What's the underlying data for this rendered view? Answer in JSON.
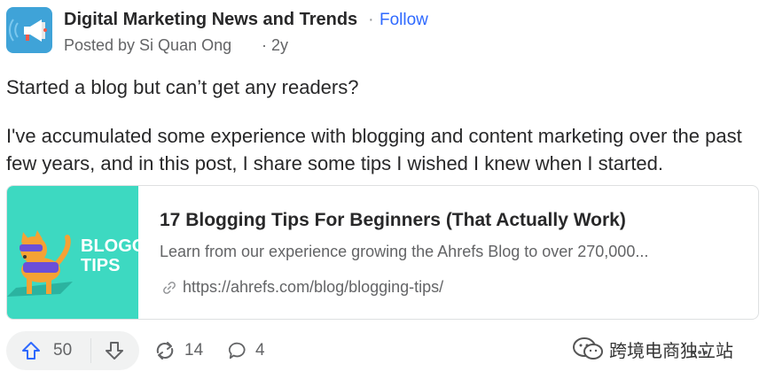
{
  "post": {
    "space_name": "Digital Marketing News and Trends",
    "separator": "·",
    "follow_label": "Follow",
    "posted_by": "Posted by Si Quan Ong",
    "time": "· 2y",
    "title": "Started a blog but can’t get any readers?",
    "body": "I've accumulated some experience with blogging and content marketing over the past few years, and in this post, I share some tips I wished I knew when I started."
  },
  "link_card": {
    "thumb_text_line1": "BLOGG",
    "thumb_text_line2": "TIPS",
    "title": "17 Blogging Tips For Beginners (That Actually Work)",
    "description": "Learn from our experience growing the Ahrefs Blog to over 270,000...",
    "url": "https://ahrefs.com/blog/blogging-tips/"
  },
  "actions": {
    "upvotes": "50",
    "shares": "14",
    "comments": "4"
  },
  "watermark": {
    "text": "跨境电商独立站"
  },
  "icons": {
    "avatar": "megaphone-icon",
    "upvote": "arrow-up-icon",
    "downvote": "arrow-down-icon",
    "share": "share-icon",
    "comment": "comment-icon",
    "link": "link-icon",
    "more": "more-icon"
  },
  "colors": {
    "accent": "#2e69ff",
    "text": "#282829",
    "secondary": "#636466",
    "thumb_bg": "#3dd9c1",
    "avatar_bg": "#3fa3d8"
  }
}
